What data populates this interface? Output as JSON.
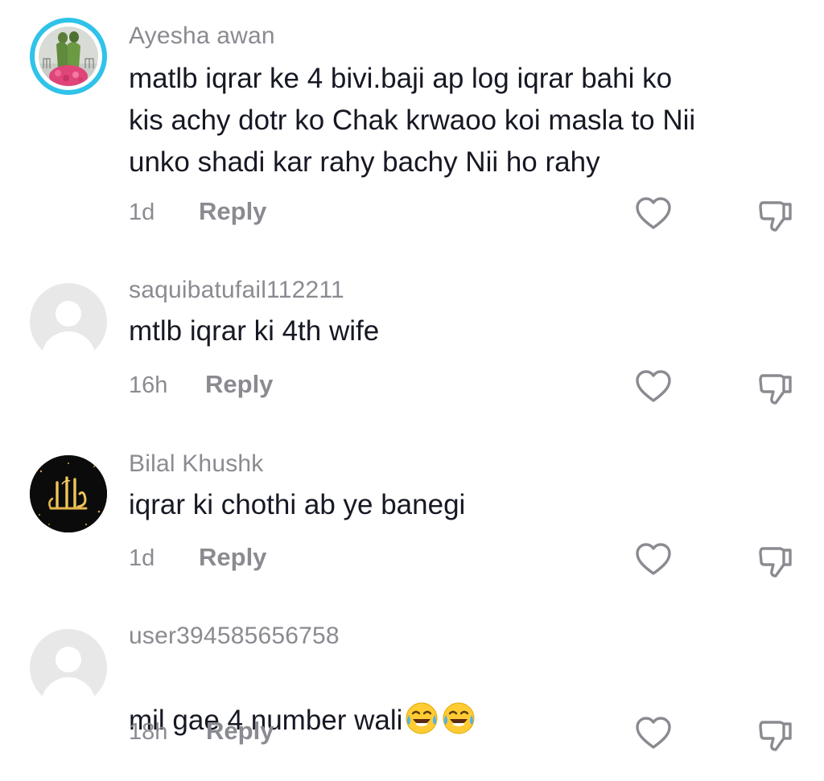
{
  "comments": [
    {
      "username": "Ayesha awan",
      "text": "matlb iqrar ke 4 bivi.baji ap log iqrar bahi ko\nkis achy dotr ko Chak krwaoo koi masla to Nii\nunko shadi kar rahy bachy Nii ho rahy",
      "time": "1d",
      "reply_label": "Reply",
      "avatar": "photo-couple-flowers"
    },
    {
      "username": "saquibatufail112211",
      "text": "mtlb iqrar ki 4th wife",
      "time": "16h",
      "reply_label": "Reply",
      "avatar": "default-avatar"
    },
    {
      "username": "Bilal Khushk",
      "text": "iqrar ki chothi ab ye banegi",
      "time": "1d",
      "reply_label": "Reply",
      "avatar": "calligraphy-allah"
    },
    {
      "username": "user394585656758",
      "text": "mil gae 4 number wali",
      "emoji": "😂😂",
      "time": "18h",
      "reply_label": "Reply",
      "avatar": "default-avatar"
    }
  ],
  "icons": {
    "like": "heart-outline-icon",
    "dislike": "thumbs-down-outline-icon"
  },
  "colors": {
    "text": "#161823",
    "muted": "#8a8b91",
    "ring": "#2fc3ea",
    "avatar_placeholder": "#e8e8e8"
  }
}
